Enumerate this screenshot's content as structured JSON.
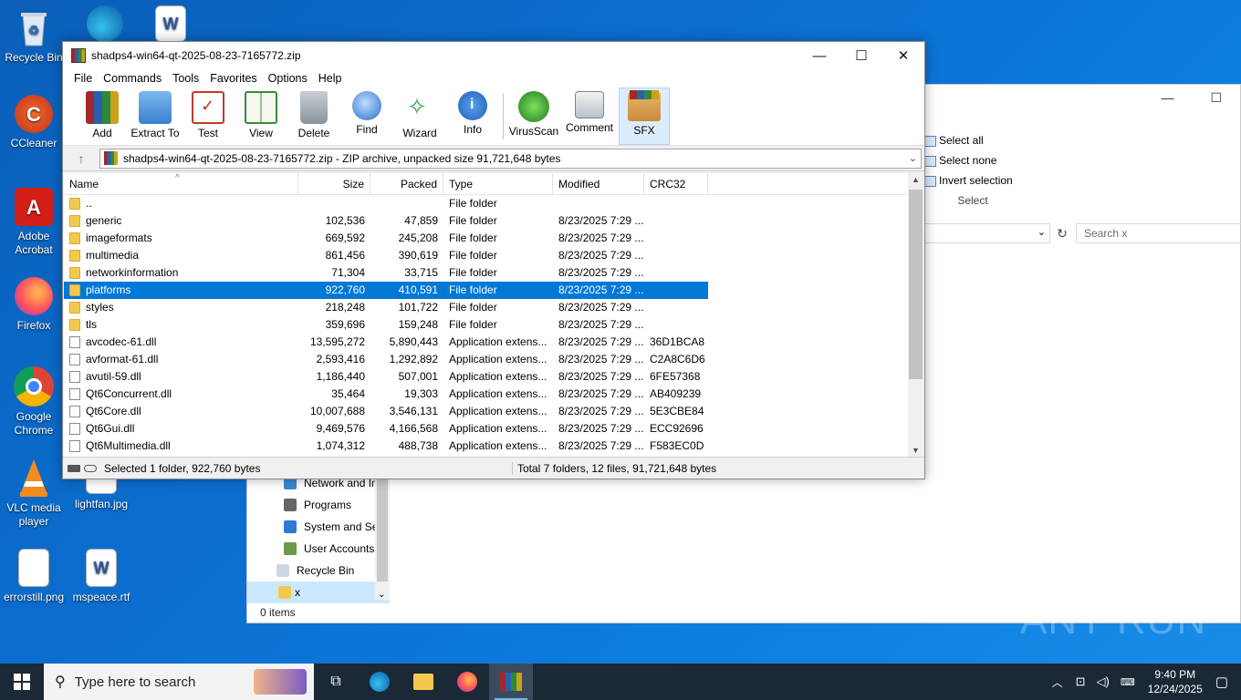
{
  "desktop": {
    "icons": [
      {
        "label": "Recycle Bin"
      },
      {
        "label": "CCleaner"
      },
      {
        "label": "Adobe Acrobat"
      },
      {
        "label": "Firefox"
      },
      {
        "label": "Google Chrome"
      },
      {
        "label": "VLC media player"
      },
      {
        "label": "lightfan.jpg"
      },
      {
        "label": "errorstill.png"
      },
      {
        "label": "mspeace.rtf"
      }
    ]
  },
  "explorer": {
    "ribbon": {
      "select_all": "Select all",
      "select_none": "Select none",
      "invert_selection": "Invert selection",
      "group_label": "Select"
    },
    "search_placeholder": "Search x",
    "nav": [
      {
        "label": "Network and In"
      },
      {
        "label": "Programs"
      },
      {
        "label": "System and Se"
      },
      {
        "label": "User Accounts"
      },
      {
        "label": "Recycle Bin"
      },
      {
        "label": "x"
      }
    ],
    "status": "0 items"
  },
  "winrar": {
    "title": "shadps4-win64-qt-2025-08-23-7165772.zip",
    "menu": [
      "File",
      "Commands",
      "Tools",
      "Favorites",
      "Options",
      "Help"
    ],
    "toolbar": [
      {
        "label": "Add",
        "icon": "add-icon"
      },
      {
        "label": "Extract To",
        "icon": "extract-icon"
      },
      {
        "label": "Test",
        "icon": "test-icon"
      },
      {
        "label": "View",
        "icon": "view-icon"
      },
      {
        "label": "Delete",
        "icon": "delete-icon"
      },
      {
        "label": "Find",
        "icon": "find-icon"
      },
      {
        "label": "Wizard",
        "icon": "wizard-icon"
      },
      {
        "label": "Info",
        "icon": "info-icon"
      },
      {
        "label": "VirusScan",
        "icon": "virusscan-icon"
      },
      {
        "label": "Comment",
        "icon": "comment-icon"
      },
      {
        "label": "SFX",
        "icon": "sfx-icon"
      }
    ],
    "path": "shadps4-win64-qt-2025-08-23-7165772.zip - ZIP archive, unpacked size 91,721,648 bytes",
    "columns": {
      "name": "Name",
      "size": "Size",
      "packed": "Packed",
      "type": "Type",
      "modified": "Modified",
      "crc": "CRC32"
    },
    "files": [
      {
        "name": "..",
        "size": "",
        "packed": "",
        "type": "File folder",
        "modified": "",
        "crc": "",
        "kind": "folder"
      },
      {
        "name": "generic",
        "size": "102,536",
        "packed": "47,859",
        "type": "File folder",
        "modified": "8/23/2025 7:29 ...",
        "crc": "",
        "kind": "folder"
      },
      {
        "name": "imageformats",
        "size": "669,592",
        "packed": "245,208",
        "type": "File folder",
        "modified": "8/23/2025 7:29 ...",
        "crc": "",
        "kind": "folder"
      },
      {
        "name": "multimedia",
        "size": "861,456",
        "packed": "390,619",
        "type": "File folder",
        "modified": "8/23/2025 7:29 ...",
        "crc": "",
        "kind": "folder"
      },
      {
        "name": "networkinformation",
        "size": "71,304",
        "packed": "33,715",
        "type": "File folder",
        "modified": "8/23/2025 7:29 ...",
        "crc": "",
        "kind": "folder"
      },
      {
        "name": "platforms",
        "size": "922,760",
        "packed": "410,591",
        "type": "File folder",
        "modified": "8/23/2025 7:29 ...",
        "crc": "",
        "kind": "folder",
        "selected": true
      },
      {
        "name": "styles",
        "size": "218,248",
        "packed": "101,722",
        "type": "File folder",
        "modified": "8/23/2025 7:29 ...",
        "crc": "",
        "kind": "folder"
      },
      {
        "name": "tls",
        "size": "359,696",
        "packed": "159,248",
        "type": "File folder",
        "modified": "8/23/2025 7:29 ...",
        "crc": "",
        "kind": "folder"
      },
      {
        "name": "avcodec-61.dll",
        "size": "13,595,272",
        "packed": "5,890,443",
        "type": "Application extens...",
        "modified": "8/23/2025 7:29 ...",
        "crc": "36D1BCA8",
        "kind": "dll"
      },
      {
        "name": "avformat-61.dll",
        "size": "2,593,416",
        "packed": "1,292,892",
        "type": "Application extens...",
        "modified": "8/23/2025 7:29 ...",
        "crc": "C2A8C6D6",
        "kind": "dll"
      },
      {
        "name": "avutil-59.dll",
        "size": "1,186,440",
        "packed": "507,001",
        "type": "Application extens...",
        "modified": "8/23/2025 7:29 ...",
        "crc": "6FE57368",
        "kind": "dll"
      },
      {
        "name": "Qt6Concurrent.dll",
        "size": "35,464",
        "packed": "19,303",
        "type": "Application extens...",
        "modified": "8/23/2025 7:29 ...",
        "crc": "AB409239",
        "kind": "dll"
      },
      {
        "name": "Qt6Core.dll",
        "size": "10,007,688",
        "packed": "3,546,131",
        "type": "Application extens...",
        "modified": "8/23/2025 7:29 ...",
        "crc": "5E3CBE84",
        "kind": "dll"
      },
      {
        "name": "Qt6Gui.dll",
        "size": "9,469,576",
        "packed": "4,166,568",
        "type": "Application extens...",
        "modified": "8/23/2025 7:29 ...",
        "crc": "ECC92696",
        "kind": "dll"
      },
      {
        "name": "Qt6Multimedia.dll",
        "size": "1,074,312",
        "packed": "488,738",
        "type": "Application extens...",
        "modified": "8/23/2025 7:29 ...",
        "crc": "F583EC0D",
        "kind": "dll"
      }
    ],
    "status_left": "Selected 1 folder, 922,760 bytes",
    "status_right": "Total 7 folders, 12 files, 91,721,648 bytes"
  },
  "taskbar": {
    "search_placeholder": "Type here to search",
    "time": "9:40 PM",
    "date": "12/24/2025"
  },
  "watermark": "ANY RUN",
  "colors": {
    "selection": "#0078d7",
    "taskbar": "#1b2836",
    "desktop": "#0b6fd1"
  }
}
